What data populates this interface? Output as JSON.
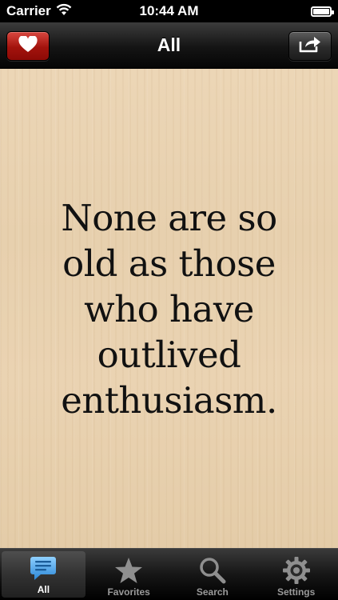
{
  "status_bar": {
    "carrier": "Carrier",
    "time": "10:44 AM",
    "battery_level": 1.0
  },
  "nav_bar": {
    "title": "All",
    "left_button_icon": "heart-icon",
    "right_button_icon": "share-icon"
  },
  "quote": {
    "text": "None are so old as those who have outlived enthusiasm."
  },
  "tab_bar": {
    "tabs": [
      {
        "label": "All",
        "icon": "speech-bubble-icon",
        "selected": true
      },
      {
        "label": "Favorites",
        "icon": "star-icon",
        "selected": false
      },
      {
        "label": "Search",
        "icon": "search-icon",
        "selected": false
      },
      {
        "label": "Settings",
        "icon": "gear-icon",
        "selected": false
      }
    ]
  },
  "colors": {
    "favorite_button": "#b21d16",
    "selected_tab_icon": "#4ba8ee",
    "unselected_tab_icon": "#8f8f8f"
  }
}
